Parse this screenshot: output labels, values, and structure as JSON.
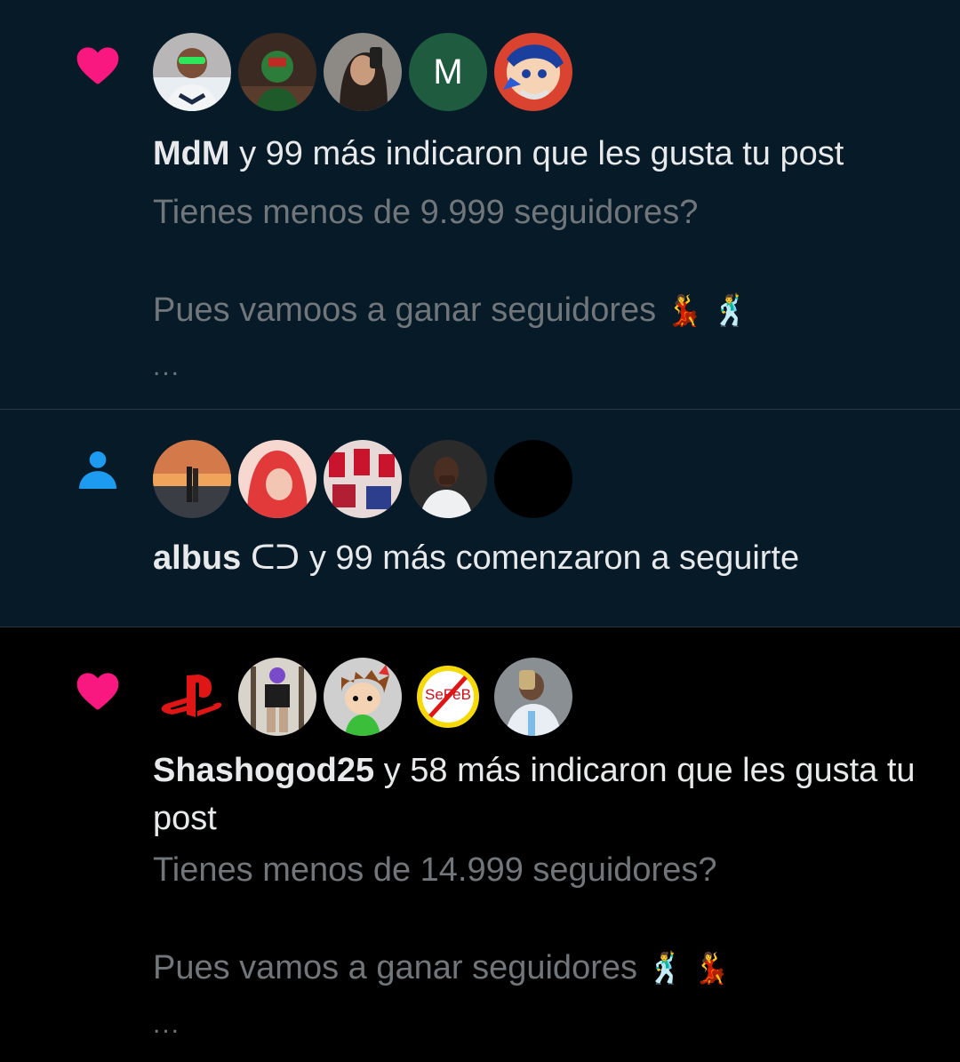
{
  "notifications": [
    {
      "type": "like",
      "icon": "heart-icon",
      "avatars": [
        "photo",
        "photo",
        "photo",
        "M",
        "photo"
      ],
      "actor": "MdM",
      "action": "y 99 más indicaron que les gusta tu post",
      "post_line1": "Tienes menos de 9.999 seguidores?",
      "post_line2": "Pues vamoos a ganar seguidores",
      "post_emoji": "💃 🕺",
      "more": "..."
    },
    {
      "type": "follow",
      "icon": "person-icon",
      "avatars": [
        "photo",
        "photo",
        "photo",
        "photo",
        "photo"
      ],
      "actor": "albus",
      "actor_badge": "ᑕᑐ",
      "action": "y 99 más comenzaron a seguirte"
    },
    {
      "type": "like",
      "icon": "heart-icon",
      "avatars": [
        "playstation-logo",
        "photo",
        "photo",
        "SeFeB",
        "photo"
      ],
      "actor": "Shashogod25",
      "action": "y 58 más indicaron que les gusta tu post",
      "post_line1": "Tienes menos de 14.999 seguidores?",
      "post_line2": "Pues vamos a ganar seguidores",
      "post_emoji": "🕺 💃",
      "more": "..."
    }
  ],
  "colors": {
    "unread_bg": "#061a27",
    "read_bg": "#000000",
    "heart": "#f91880",
    "person": "#1d9bf0",
    "text_primary": "#e7e9ea",
    "text_secondary": "#71767b"
  }
}
